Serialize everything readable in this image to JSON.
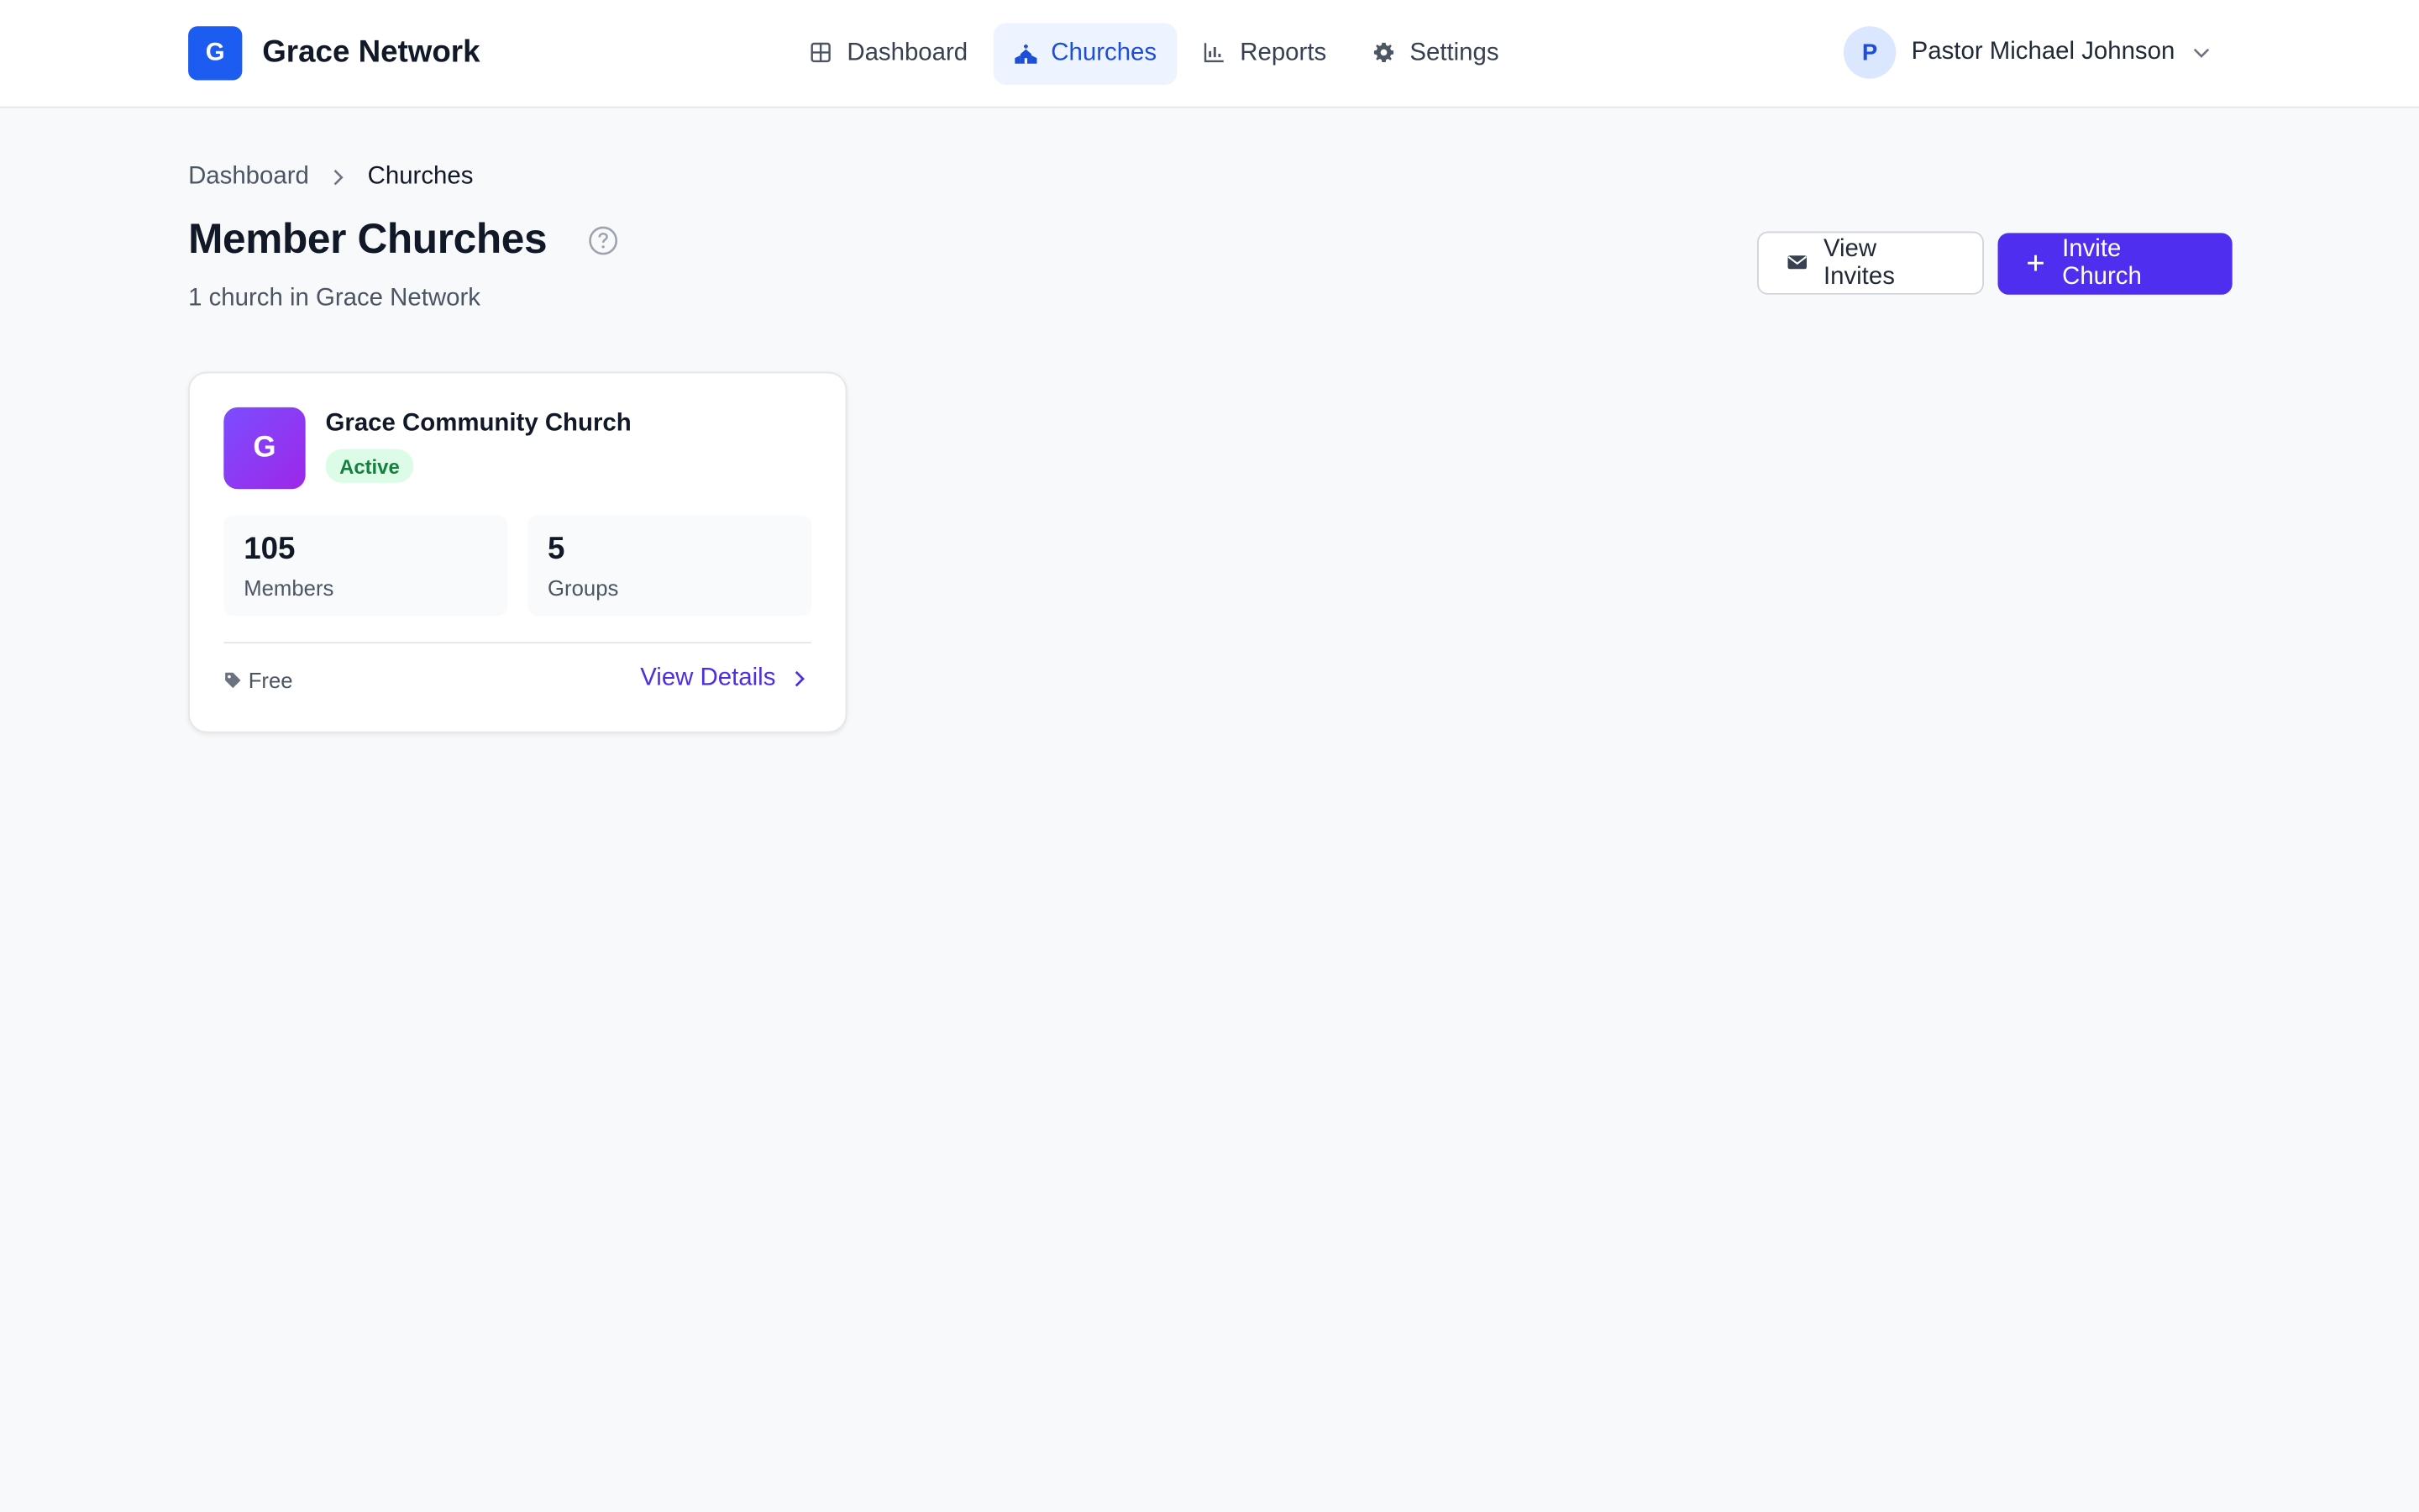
{
  "brand": {
    "logo_letter": "G",
    "name": "Grace Network"
  },
  "nav": {
    "items": [
      {
        "label": "Dashboard",
        "icon": "grid-icon",
        "active": false
      },
      {
        "label": "Churches",
        "icon": "church-icon",
        "active": true
      },
      {
        "label": "Reports",
        "icon": "bar-chart-icon",
        "active": false
      },
      {
        "label": "Settings",
        "icon": "gear-icon",
        "active": false
      }
    ]
  },
  "user": {
    "avatar_letter": "P",
    "name": "Pastor Michael Johnson"
  },
  "breadcrumb": {
    "parent": "Dashboard",
    "current": "Churches"
  },
  "header": {
    "title": "Member Churches",
    "subtitle": "1 church in Grace Network"
  },
  "actions": {
    "view_invites": "View Invites",
    "invite_church": "Invite Church"
  },
  "church_card": {
    "logo_letter": "G",
    "name": "Grace Community Church",
    "status": "Active",
    "stats": {
      "members_value": "105",
      "members_label": "Members",
      "groups_value": "5",
      "groups_label": "Groups"
    },
    "plan": "Free",
    "details_link": "View Details"
  },
  "colors": {
    "primary": "#4f2ef0",
    "brand_blue": "#1d5cf0",
    "active_nav_bg": "#eef4ff",
    "active_nav_text": "#1d4ed8",
    "status_green_bg": "#dcfce7",
    "status_green_text": "#15803d"
  }
}
